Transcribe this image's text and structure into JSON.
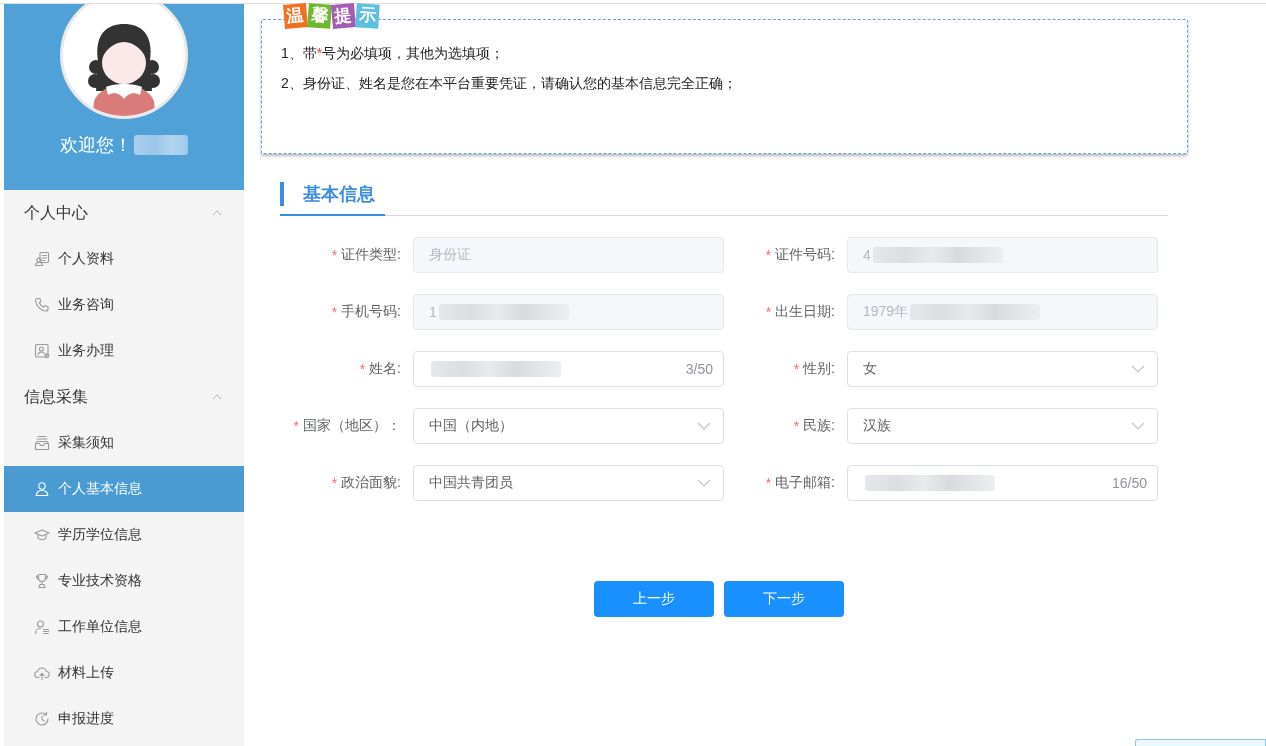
{
  "sidebar": {
    "welcome": {
      "text": "欢迎您！",
      "redacted": true
    },
    "menu": [
      {
        "label": "个人中心",
        "expanded": true,
        "children": [
          {
            "label": "个人资料",
            "selected": false
          },
          {
            "label": "业务咨询",
            "selected": false
          },
          {
            "label": "业务办理",
            "selected": false
          }
        ]
      },
      {
        "label": "信息采集",
        "expanded": true,
        "children": [
          {
            "label": "采集须知",
            "selected": false
          },
          {
            "label": "个人基本信息",
            "selected": true
          },
          {
            "label": "学历学位信息",
            "selected": false
          },
          {
            "label": "专业技术资格",
            "selected": false
          },
          {
            "label": "工作单位信息",
            "selected": false
          },
          {
            "label": "材料上传",
            "selected": false
          },
          {
            "label": "申报进度",
            "selected": false
          }
        ]
      }
    ]
  },
  "notice": {
    "badge": [
      {
        "text": "温",
        "color": "#f26f21"
      },
      {
        "text": "馨",
        "color": "#6cb92f"
      },
      {
        "text": "提",
        "color": "#a45bb3"
      },
      {
        "text": "示",
        "color": "#5bbfe0"
      }
    ],
    "lines": [
      {
        "segments": [
          {
            "kind": "text",
            "text": "1、带"
          },
          {
            "kind": "required_mark",
            "text": "*"
          },
          {
            "kind": "text",
            "text": "号为必填项，其他为选填项；"
          }
        ]
      },
      {
        "segments": [
          {
            "kind": "text",
            "text": "2、身份证、姓名是您在本平台重要凭证，请确认您的基本信息完全正确；"
          }
        ]
      }
    ]
  },
  "section": {
    "title": "基本信息"
  },
  "form": {
    "fields": [
      {
        "label": "证件类型:",
        "required": true,
        "kind": "text",
        "disabled": true,
        "redacted": false,
        "value": "身份证"
      },
      {
        "label": "证件号码:",
        "required": true,
        "kind": "text",
        "disabled": true,
        "redacted": true,
        "value": "4"
      },
      {
        "label": "手机号码:",
        "required": true,
        "kind": "text",
        "disabled": true,
        "redacted": true,
        "value": "1"
      },
      {
        "label": "出生日期:",
        "required": true,
        "kind": "text",
        "disabled": true,
        "redacted": true,
        "value": "1979年"
      },
      {
        "label": "姓名:",
        "required": true,
        "kind": "text",
        "disabled": false,
        "redacted": true,
        "counter": "3/50"
      },
      {
        "label": "性别:",
        "required": true,
        "kind": "select",
        "disabled": false,
        "redacted": false,
        "value": "女"
      },
      {
        "label": "国家（地区）：",
        "required": true,
        "kind": "select",
        "disabled": false,
        "redacted": false,
        "value": "中国（内地）"
      },
      {
        "label": "民族:",
        "required": true,
        "kind": "select",
        "disabled": false,
        "redacted": false,
        "value": "汉族"
      },
      {
        "label": "政治面貌:",
        "required": true,
        "kind": "select",
        "disabled": false,
        "redacted": false,
        "value": "中国共青团员"
      },
      {
        "label": "电子邮箱:",
        "required": true,
        "kind": "text",
        "disabled": false,
        "redacted": true,
        "counter": "16/50"
      }
    ]
  },
  "buttons": [
    {
      "label": "上一步"
    },
    {
      "label": "下一步"
    }
  ]
}
